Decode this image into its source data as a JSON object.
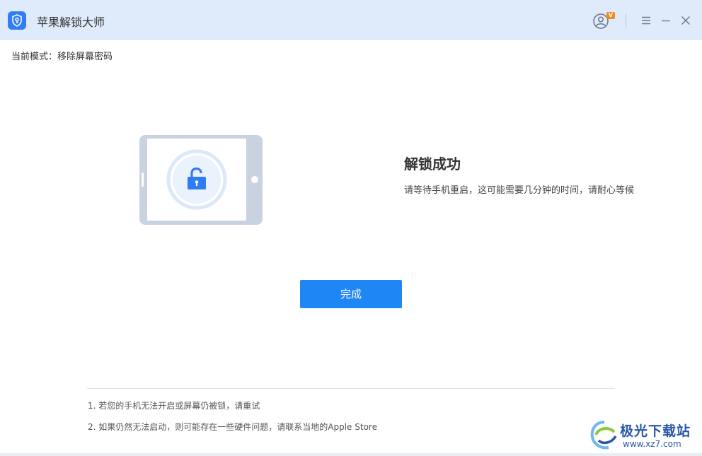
{
  "window": {
    "title": "苹果解锁大师",
    "vip_badge": "V"
  },
  "mode": {
    "label": "当前模式：移除屏幕密码"
  },
  "result": {
    "title": "解锁成功",
    "description": "请等待手机重启，这可能需要几分钟的时间，请耐心等候"
  },
  "actions": {
    "done_label": "完成"
  },
  "tips": [
    "1. 若您的手机无法开启或屏幕仍被锁，请重试",
    "2. 如果仍然无法启动，则可能存在一些硬件问题，请联系当地的Apple Store"
  ],
  "watermark": {
    "name": "极光下载站",
    "url": "www.xz7.com"
  },
  "colors": {
    "accent": "#1f86f5",
    "titlebar": "#dfeafb",
    "device_frame": "#c9d2e0",
    "lock": "#2f7cf6"
  },
  "icons": {
    "app": "shield-key-icon",
    "user": "user-avatar-icon",
    "menu": "menu-icon",
    "minimize": "minimize-icon",
    "close": "close-icon",
    "unlock": "unlocked-padlock-icon"
  }
}
